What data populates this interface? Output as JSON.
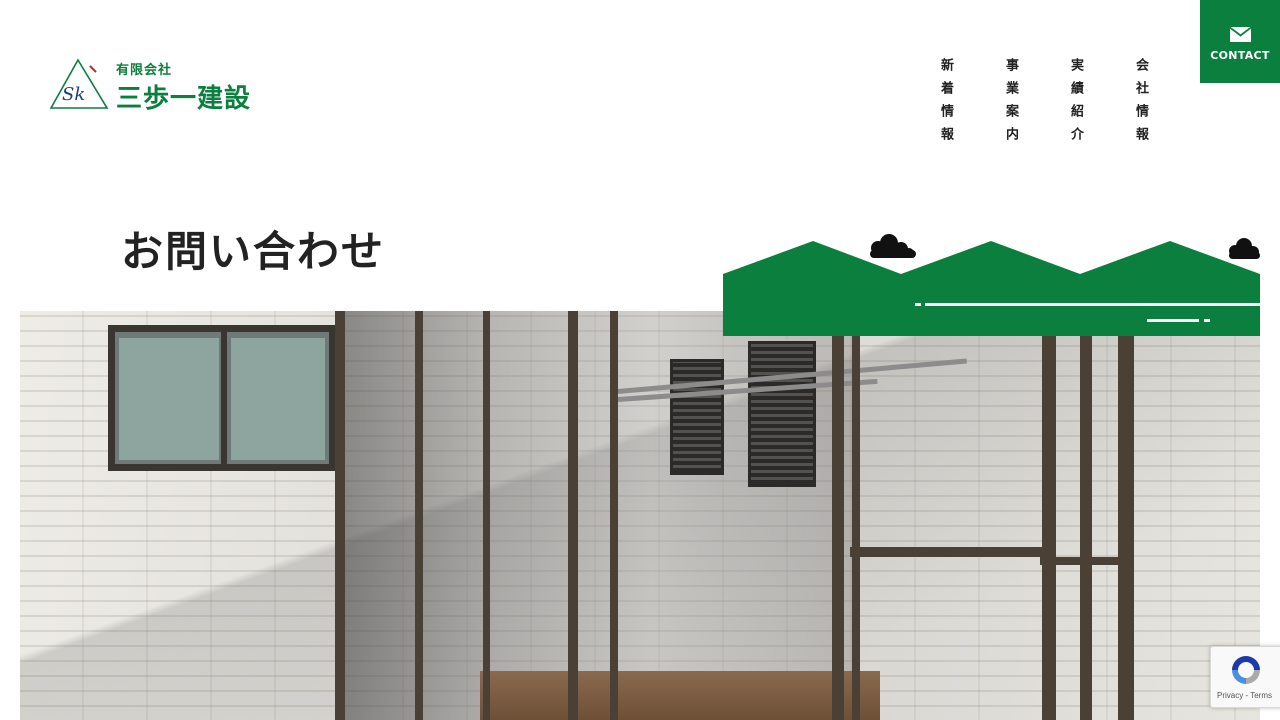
{
  "colors": {
    "brand_green": "#0b7f3d",
    "text_dark": "#222222",
    "background": "#ffffff"
  },
  "header": {
    "logo": {
      "monogram": "Sk",
      "company_type": "有限会社",
      "company_name": "三歩一建設"
    },
    "nav": [
      {
        "label": "新着情報"
      },
      {
        "label": "事業案内"
      },
      {
        "label": "実績紹介"
      },
      {
        "label": "会社情報"
      }
    ],
    "contact": {
      "label": "CONTACT",
      "icon": "mail-icon"
    }
  },
  "main": {
    "page_title": "お問い合わせ",
    "hero_image": "sunroom-photo"
  },
  "recaptcha": {
    "privacy": "Privacy",
    "separator": " - ",
    "terms": "Terms"
  }
}
